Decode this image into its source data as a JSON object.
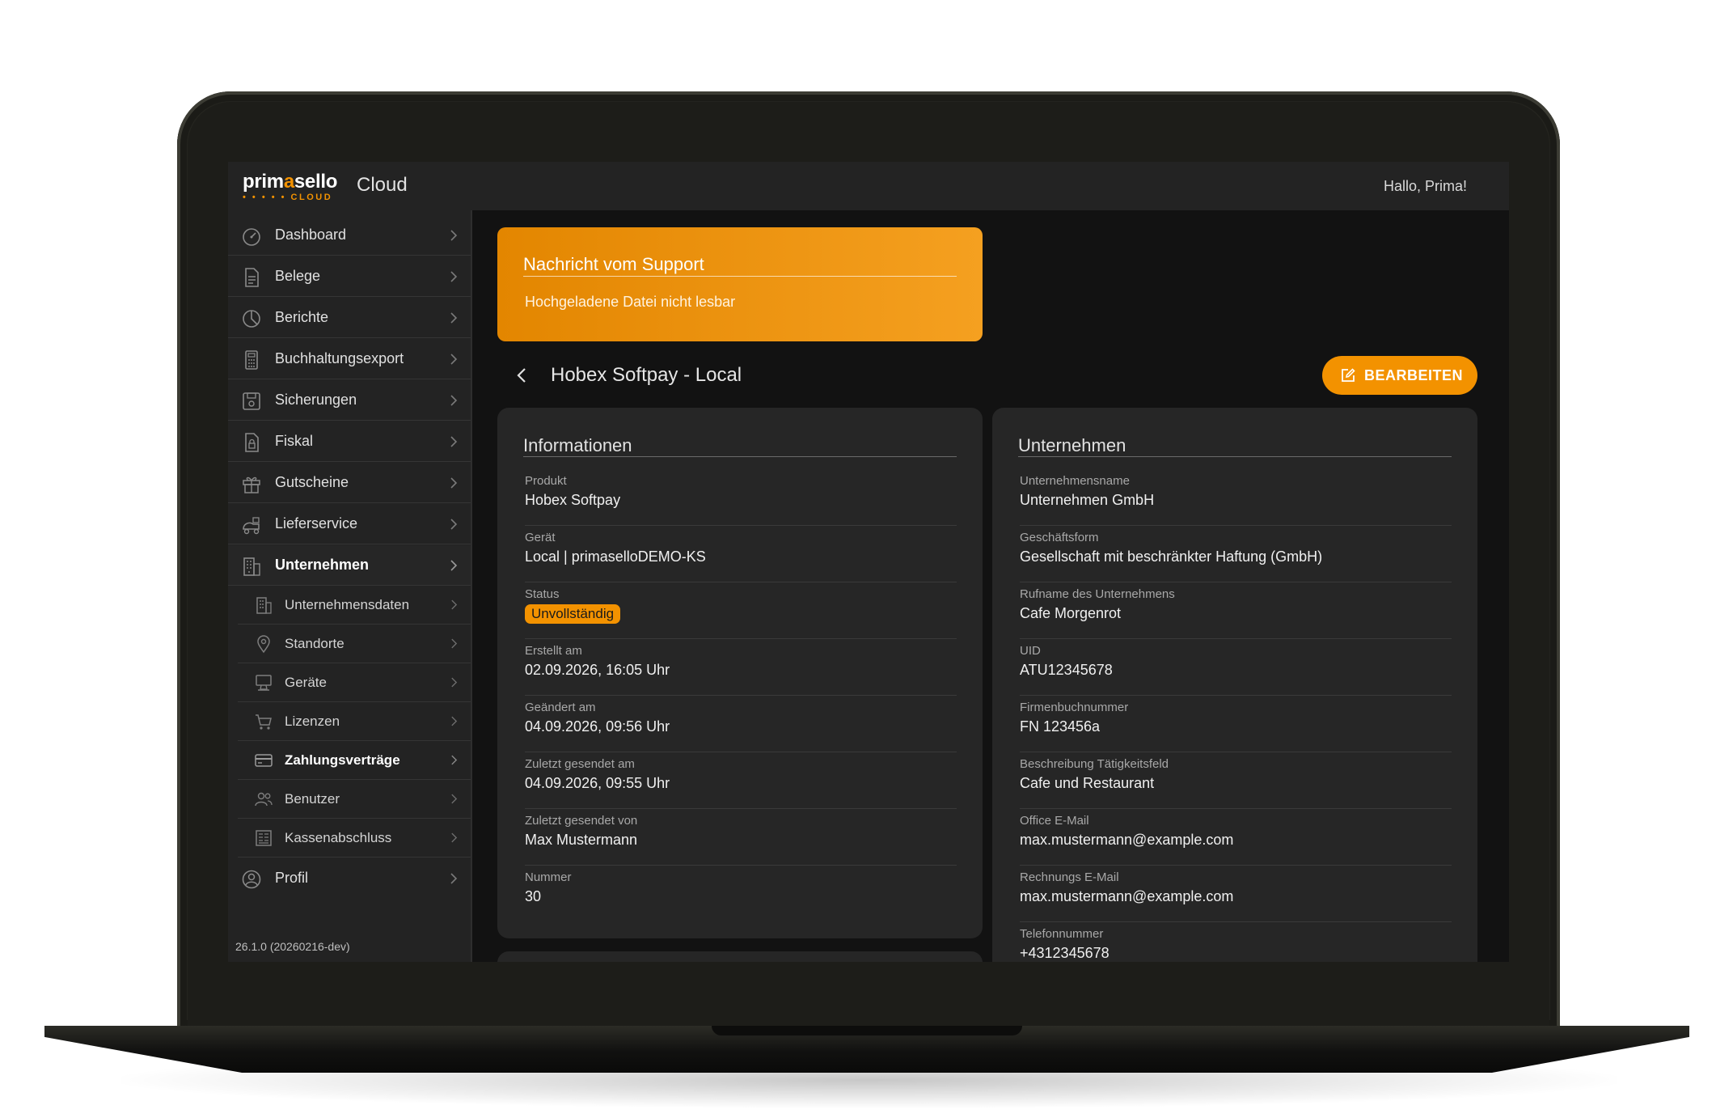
{
  "header": {
    "logo_text_pre": "prim",
    "logo_text_accent": "a",
    "logo_text_post": "sello",
    "logo_sub": "• • • • • CLOUD",
    "app_name": "Cloud",
    "greeting": "Hallo, Prima!"
  },
  "sidebar": {
    "items": [
      {
        "label": "Dashboard",
        "icon": "dashboard-icon"
      },
      {
        "label": "Belege",
        "icon": "document-icon"
      },
      {
        "label": "Berichte",
        "icon": "pie-chart-icon"
      },
      {
        "label": "Buchhaltungsexport",
        "icon": "calculator-icon"
      },
      {
        "label": "Sicherungen",
        "icon": "save-icon"
      },
      {
        "label": "Fiskal",
        "icon": "lock-document-icon"
      },
      {
        "label": "Gutscheine",
        "icon": "gift-icon"
      },
      {
        "label": "Lieferservice",
        "icon": "delivery-icon"
      },
      {
        "label": "Unternehmen",
        "icon": "building-icon",
        "active": true
      }
    ],
    "sub_items": [
      {
        "label": "Unternehmensdaten",
        "icon": "building-icon"
      },
      {
        "label": "Standorte",
        "icon": "location-pin-icon"
      },
      {
        "label": "Geräte",
        "icon": "pos-terminal-icon"
      },
      {
        "label": "Lizenzen",
        "icon": "cart-icon"
      },
      {
        "label": "Zahlungsverträge",
        "icon": "credit-card-icon",
        "active": true
      },
      {
        "label": "Benutzer",
        "icon": "users-icon"
      },
      {
        "label": "Kassenabschluss",
        "icon": "report-icon"
      }
    ],
    "profile": {
      "label": "Profil",
      "icon": "user-circle-icon"
    },
    "version": "26.1.0 (20260216-dev)"
  },
  "support": {
    "title": "Nachricht vom Support",
    "message": "Hochgeladene Datei nicht lesbar"
  },
  "page": {
    "title": "Hobex Softpay - Local",
    "edit_label": "BEARBEITEN"
  },
  "info_card": {
    "title": "Informationen",
    "fields": [
      {
        "label": "Produkt",
        "value": "Hobex Softpay"
      },
      {
        "label": "Gerät",
        "value": "Local | primaselloDEMO-KS"
      },
      {
        "label": "Status",
        "value": "Unvollständig"
      },
      {
        "label": "Erstellt am",
        "value": "02.09.2026, 16:05 Uhr"
      },
      {
        "label": "Geändert am",
        "value": "04.09.2026, 09:56 Uhr"
      },
      {
        "label": "Zuletzt gesendet am",
        "value": "04.09.2026, 09:55 Uhr"
      },
      {
        "label": "Zuletzt gesendet von",
        "value": "Max Mustermann"
      },
      {
        "label": "Nummer",
        "value": "30"
      }
    ]
  },
  "company_card": {
    "title": "Unternehmen",
    "fields": [
      {
        "label": "Unternehmensname",
        "value": "Unternehmen GmbH"
      },
      {
        "label": "Geschäftsform",
        "value": "Gesellschaft mit beschränkter Haftung (GmbH)"
      },
      {
        "label": "Rufname des Unternehmens",
        "value": "Cafe Morgenrot"
      },
      {
        "label": "UID",
        "value": "ATU12345678"
      },
      {
        "label": "Firmenbuchnummer",
        "value": "FN 123456a"
      },
      {
        "label": "Beschreibung Tätigkeitsfeld",
        "value": "Cafe und Restaurant"
      },
      {
        "label": "Office E-Mail",
        "value": "max.mustermann@example.com"
      },
      {
        "label": "Rechnungs E-Mail",
        "value": "max.mustermann@example.com"
      },
      {
        "label": "Telefonnummer",
        "value": "+4312345678"
      }
    ]
  },
  "colors": {
    "accent": "#f39200",
    "background": "#121212",
    "panel": "#232323",
    "card": "#262626"
  }
}
